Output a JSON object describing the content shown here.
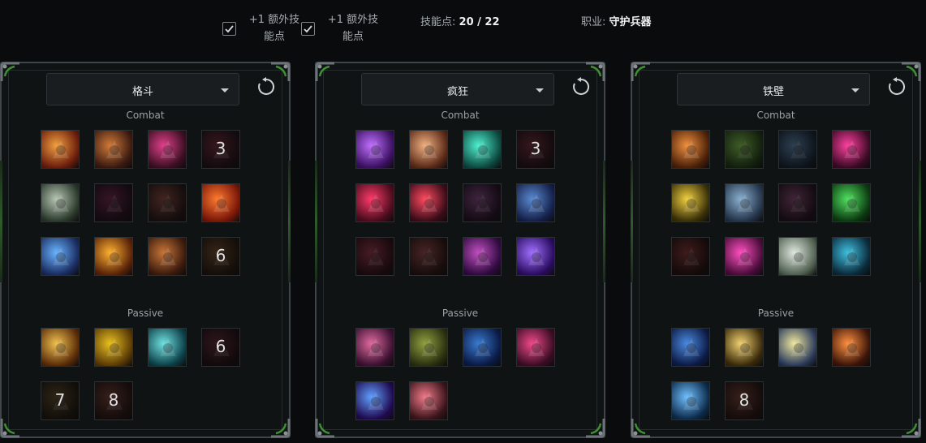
{
  "options": [
    {
      "label": "+1 额外技能点",
      "checked": true
    },
    {
      "label": "+1 额外技能点",
      "checked": true
    }
  ],
  "skill_points": {
    "label": "技能点:",
    "value": "20 / 22"
  },
  "profession": {
    "label": "职业:",
    "value": "守护兵器"
  },
  "panels": [
    {
      "spec": "格斗",
      "section_combat": "Combat",
      "section_passive": "Passive",
      "combat": [
        {
          "icon": "blade-slash-icon",
          "colors": [
            "#f2a040",
            "#6a1d0c"
          ]
        },
        {
          "icon": "sword-thrust-icon",
          "colors": [
            "#d07a3a",
            "#3a1a10"
          ]
        },
        {
          "icon": "kick-icon",
          "colors": [
            "#e0408a",
            "#3a0f22"
          ]
        },
        {
          "icon": "locked-slot-icon",
          "colors": [
            "#5a2030",
            "#1a0c10"
          ],
          "num": "3",
          "dim": true
        },
        {
          "icon": "shockwave-icon",
          "colors": [
            "#b8c6b5",
            "#2c3a2c"
          ]
        },
        {
          "icon": "shadow-strike-icon",
          "colors": [
            "#5a1d3c",
            "#190a12"
          ],
          "dim": true
        },
        {
          "icon": "blade-dash-icon",
          "colors": [
            "#6e3a32",
            "#1e1010"
          ],
          "dim": true
        },
        {
          "icon": "vortex-icon",
          "colors": [
            "#ff7a30",
            "#7a1708"
          ]
        },
        {
          "icon": "lightning-strike-icon",
          "colors": [
            "#69b4ff",
            "#1a2c60"
          ]
        },
        {
          "icon": "flame-figure-icon",
          "colors": [
            "#ffb030",
            "#5a2408"
          ]
        },
        {
          "icon": "hammer-icon",
          "colors": [
            "#c8763a",
            "#3a1a0c"
          ]
        },
        {
          "icon": "locked-slot-icon",
          "colors": [
            "#5a3a22",
            "#1c120a"
          ],
          "num": "6",
          "dim": true
        }
      ],
      "passive": [
        {
          "icon": "warrior-spear-icon",
          "colors": [
            "#f0c050",
            "#5a2c08"
          ]
        },
        {
          "icon": "ninja-icon",
          "colors": [
            "#e8c020",
            "#5a3a06"
          ]
        },
        {
          "icon": "wind-burst-icon",
          "colors": [
            "#70e0e0",
            "#0c4048"
          ]
        },
        {
          "icon": "locked-slot-icon",
          "colors": [
            "#4a2028",
            "#180a0e"
          ],
          "num": "6",
          "dim": true
        },
        {
          "icon": "locked-slot-icon",
          "colors": [
            "#4a3a20",
            "#18120a"
          ],
          "num": "7",
          "dim": true
        },
        {
          "icon": "locked-slot-icon",
          "colors": [
            "#5a3028",
            "#1c0e0c"
          ],
          "num": "8",
          "dim": true
        }
      ]
    },
    {
      "spec": "疯狂",
      "section_combat": "Combat",
      "section_passive": "Passive",
      "combat": [
        {
          "icon": "shotgun-icon",
          "colors": [
            "#c070ff",
            "#3a1060"
          ]
        },
        {
          "icon": "fist-icon",
          "colors": [
            "#f0b080",
            "#5a2a18"
          ]
        },
        {
          "icon": "shock-bullet-icon",
          "colors": [
            "#50f0d0",
            "#0c4a40"
          ]
        },
        {
          "icon": "locked-slot-icon",
          "colors": [
            "#5a2030",
            "#1a0c10"
          ],
          "num": "3",
          "dim": true
        },
        {
          "icon": "spiked-mine-icon",
          "colors": [
            "#ff3a6a",
            "#4a0c1c"
          ]
        },
        {
          "icon": "rocket-icon",
          "colors": [
            "#ff4a60",
            "#3a0c18"
          ]
        },
        {
          "icon": "hooded-figure-icon",
          "colors": [
            "#6a3a6a",
            "#1c0c1c"
          ],
          "dim": true
        },
        {
          "icon": "brawler-icon",
          "colors": [
            "#5a8ad0",
            "#14204a"
          ]
        },
        {
          "icon": "claw-marks-icon",
          "colors": [
            "#7a2a3a",
            "#220a10"
          ],
          "dim": true
        },
        {
          "icon": "grab-hand-icon",
          "colors": [
            "#7a3a3a",
            "#220e0e"
          ],
          "dim": true
        },
        {
          "icon": "demon-face-icon",
          "colors": [
            "#c050c0",
            "#300a40"
          ]
        },
        {
          "icon": "cannon-blast-icon",
          "colors": [
            "#a070ff",
            "#2a0c60"
          ]
        }
      ],
      "passive": [
        {
          "icon": "boxer-icon",
          "colors": [
            "#e06aa0",
            "#3a1030"
          ]
        },
        {
          "icon": "bullet-icon",
          "colors": [
            "#90a040",
            "#2a3010"
          ]
        },
        {
          "icon": "crosshair-icon",
          "colors": [
            "#3a7ad0",
            "#0a1a44"
          ]
        },
        {
          "icon": "sniper-icon",
          "colors": [
            "#f04a8a",
            "#3a0c24"
          ]
        },
        {
          "icon": "dash-strike-icon",
          "colors": [
            "#60a0ff",
            "#200a50"
          ]
        },
        {
          "icon": "twin-guns-icon",
          "colors": [
            "#f07a8a",
            "#3a141a"
          ]
        }
      ]
    },
    {
      "spec": "铁壁",
      "section_combat": "Combat",
      "section_passive": "Passive",
      "combat": [
        {
          "icon": "tower-shield-icon",
          "colors": [
            "#f09040",
            "#4a2008"
          ]
        },
        {
          "icon": "flex-arm-icon",
          "colors": [
            "#6aa040",
            "#1a3010"
          ],
          "dim": true
        },
        {
          "icon": "shield-bash-icon",
          "colors": [
            "#4a6a8a",
            "#101c2a"
          ],
          "dim": true
        },
        {
          "icon": "helmet-icon",
          "colors": [
            "#ff40a0",
            "#3a0a24"
          ]
        },
        {
          "icon": "lasso-icon",
          "colors": [
            "#f0d040",
            "#3a3008"
          ]
        },
        {
          "icon": "ornate-shield-icon",
          "colors": [
            "#8ab0d0",
            "#24344a"
          ]
        },
        {
          "icon": "taunt-figure-icon",
          "colors": [
            "#6a3a5a",
            "#1c0c18"
          ],
          "dim": true
        },
        {
          "icon": "arrow-up-icon",
          "colors": [
            "#50e060",
            "#0c3a10"
          ]
        },
        {
          "icon": "guard-figure-icon",
          "colors": [
            "#6a2a2a",
            "#1c0a0a"
          ],
          "dim": true
        },
        {
          "icon": "heal-plus-icon",
          "colors": [
            "#ff50c0",
            "#4a0c3a"
          ]
        },
        {
          "icon": "crate-icon",
          "colors": [
            "#e0e8e0",
            "#506050"
          ]
        },
        {
          "icon": "strongman-icon",
          "colors": [
            "#40c0e0",
            "#0a2a3a"
          ]
        }
      ],
      "passive": [
        {
          "icon": "heater-shield-icon",
          "colors": [
            "#4a8ae0",
            "#0c1a44"
          ]
        },
        {
          "icon": "armor-chest-icon",
          "colors": [
            "#f0d070",
            "#3a2a0a"
          ]
        },
        {
          "icon": "cross-shield-icon",
          "colors": [
            "#f0e8a0",
            "#2a3a5a"
          ]
        },
        {
          "icon": "meditate-icon",
          "colors": [
            "#ff9040",
            "#3a1408"
          ]
        },
        {
          "icon": "bear-roar-icon",
          "colors": [
            "#70c0ff",
            "#0c2a4a"
          ]
        },
        {
          "icon": "locked-slot-icon",
          "colors": [
            "#5a3028",
            "#1c0e0c"
          ],
          "num": "8",
          "dim": true
        }
      ]
    }
  ]
}
